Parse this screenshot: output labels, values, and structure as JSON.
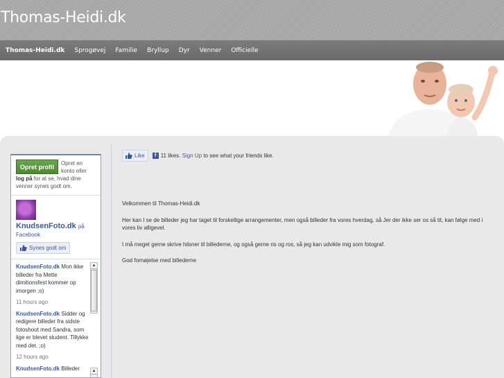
{
  "site": {
    "title": "Thomas-Heidi.dk"
  },
  "nav": {
    "items": [
      {
        "label": "Thomas-Heidi.dk",
        "active": true
      },
      {
        "label": "Sprogøvej"
      },
      {
        "label": "Familie"
      },
      {
        "label": "Bryllup"
      },
      {
        "label": "Dyr"
      },
      {
        "label": "Venner"
      },
      {
        "label": "Officielle"
      }
    ]
  },
  "facebook_box": {
    "create_profile": "Opret profil",
    "login_text_1": "Opret en konto eller",
    "login_link": "log på",
    "login_text_2": "for at se, hvad dine venner synes godt om.",
    "page_name": "KnudsenFoto.dk",
    "page_on": "på",
    "page_network": "Facebook",
    "like_page_label": "Synes godt om",
    "posts": [
      {
        "author": "KnudsenFoto.dk",
        "text": "Mon ikke billeder fra Mette dimitionsfest kommer op imorgen ;o)",
        "time": "11 hours ago"
      },
      {
        "author": "KnudsenFoto.dk",
        "text": "Sidder og redigere billeder fra sidste fotoshoot med Sandra, som lige er blevet student. Tillykke med det. ;o)",
        "time": "12 hours ago"
      },
      {
        "author": "KnudsenFoto.dk",
        "text": "Billeder",
        "time": ""
      }
    ]
  },
  "like_bar": {
    "like_label": "Like",
    "count_text": "11 likes.",
    "signup_link": "Sign Up",
    "suffix": "to see what your friends like."
  },
  "main": {
    "paragraphs": [
      "Velkommen til Thomas-Heidi.dk",
      "Her kan I se de billeder jeg har taget til forskellige arrangementer, men også billeder fra vores hverdag, så Jer der ikke ser os så tit, kan følge med i vores liv alligevel.",
      "I må meget gerne skrive hilsner til billederne, og også gerne ris og ros, så jeg kan udvikle mig som fotograf.",
      "God fornøjelse med billederne"
    ]
  },
  "colors": {
    "fb_blue": "#3b5998",
    "header_gray": "#a7a7a7",
    "nav_gray": "#707070",
    "content_bg": "#e9e9e9",
    "create_green": "#5a9a3f"
  }
}
